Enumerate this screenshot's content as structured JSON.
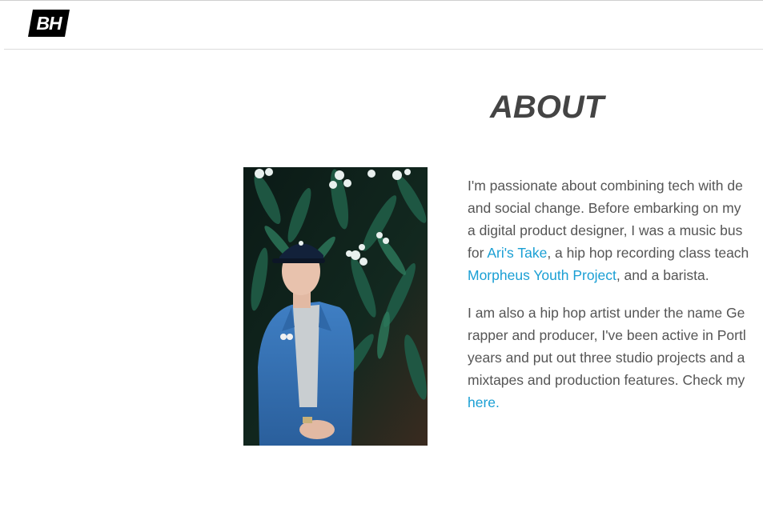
{
  "header": {
    "logo_text": "BH"
  },
  "about": {
    "title": "ABOUT",
    "photo_alt": "Portrait of a man in a denim jacket and cap standing in front of flowering foliage",
    "para1": {
      "line1": "I'm passionate about combining tech with de",
      "line2": "and social change. Before embarking on my",
      "line3": "a digital product designer, I was a music bus",
      "line4_pre": "for ",
      "link1": "Ari's Take",
      "line4_post": ", a hip hop recording class teach",
      "link2": "Morpheus Youth Project",
      "line5_post": ", and a barista."
    },
    "para2": {
      "line1": "I am also a hip hop artist under the name Ge",
      "line2": "rapper and producer, I've been active in Portl",
      "line3": "years and put out three studio projects and a",
      "line4": "mixtapes and production features. Check my",
      "link": "here."
    }
  },
  "colors": {
    "link": "#1a9fd4",
    "text": "#555555",
    "title": "#444444",
    "logo_bg": "#000000"
  }
}
